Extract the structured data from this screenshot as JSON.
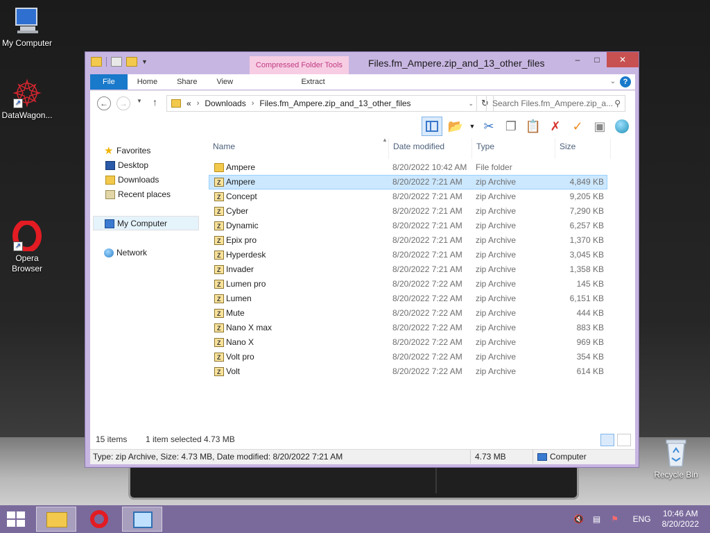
{
  "desktop": {
    "icons": [
      {
        "label": "My Computer"
      },
      {
        "label": "DataWagon..."
      },
      {
        "label": "Opera Browser"
      },
      {
        "label": "Recycle Bin"
      }
    ]
  },
  "window": {
    "title": "Files.fm_Ampere.zip_and_13_other_files",
    "context_tab_header": "Compressed Folder Tools",
    "controls": {
      "minimize": "–",
      "maximize": "□",
      "close": "✕"
    },
    "ribbon_tabs": {
      "file": "File",
      "home": "Home",
      "share": "Share",
      "view": "View",
      "extract": "Extract"
    },
    "address": {
      "overflow": "«",
      "crumbs": [
        "Downloads",
        "Files.fm_Ampere.zip_and_13_other_files"
      ]
    },
    "search_placeholder": "Search Files.fm_Ampere.zip_a...",
    "navigation": {
      "favorites": "Favorites",
      "desktop": "Desktop",
      "downloads": "Downloads",
      "recent": "Recent places",
      "computer": "My Computer",
      "network": "Network"
    },
    "columns": {
      "name": "Name",
      "date": "Date modified",
      "type": "Type",
      "size": "Size"
    },
    "files": [
      {
        "name": "Ampere",
        "date": "8/20/2022 10:42 AM",
        "type": "File folder",
        "size": "",
        "kind": "folder"
      },
      {
        "name": "Ampere",
        "date": "8/20/2022 7:21 AM",
        "type": "zip Archive",
        "size": "4,849 KB",
        "kind": "zip"
      },
      {
        "name": "Concept",
        "date": "8/20/2022 7:21 AM",
        "type": "zip Archive",
        "size": "9,205 KB",
        "kind": "zip"
      },
      {
        "name": "Cyber",
        "date": "8/20/2022 7:21 AM",
        "type": "zip Archive",
        "size": "7,290 KB",
        "kind": "zip"
      },
      {
        "name": "Dynamic",
        "date": "8/20/2022 7:21 AM",
        "type": "zip Archive",
        "size": "6,257 KB",
        "kind": "zip"
      },
      {
        "name": "Epix pro",
        "date": "8/20/2022 7:21 AM",
        "type": "zip Archive",
        "size": "1,370 KB",
        "kind": "zip"
      },
      {
        "name": "Hyperdesk",
        "date": "8/20/2022 7:21 AM",
        "type": "zip Archive",
        "size": "3,045 KB",
        "kind": "zip"
      },
      {
        "name": "Invader",
        "date": "8/20/2022 7:21 AM",
        "type": "zip Archive",
        "size": "1,358 KB",
        "kind": "zip"
      },
      {
        "name": "Lumen pro",
        "date": "8/20/2022 7:22 AM",
        "type": "zip Archive",
        "size": "145 KB",
        "kind": "zip"
      },
      {
        "name": "Lumen",
        "date": "8/20/2022 7:22 AM",
        "type": "zip Archive",
        "size": "6,151 KB",
        "kind": "zip"
      },
      {
        "name": "Mute",
        "date": "8/20/2022 7:22 AM",
        "type": "zip Archive",
        "size": "444 KB",
        "kind": "zip"
      },
      {
        "name": "Nano X max",
        "date": "8/20/2022 7:22 AM",
        "type": "zip Archive",
        "size": "883 KB",
        "kind": "zip"
      },
      {
        "name": "Nano X",
        "date": "8/20/2022 7:22 AM",
        "type": "zip Archive",
        "size": "969 KB",
        "kind": "zip"
      },
      {
        "name": "Volt pro",
        "date": "8/20/2022 7:22 AM",
        "type": "zip Archive",
        "size": "354 KB",
        "kind": "zip"
      },
      {
        "name": "Volt",
        "date": "8/20/2022 7:22 AM",
        "type": "zip Archive",
        "size": "614 KB",
        "kind": "zip"
      }
    ],
    "selected_index": 1,
    "status": {
      "count": "15 items",
      "selection": "1 item selected  4.73 MB"
    },
    "info_bar": {
      "details": "Type: zip Archive, Size: 4.73 MB, Date modified: 8/20/2022 7:21 AM",
      "size": "4.73 MB",
      "location": "Computer"
    }
  },
  "taskbar": {
    "language": "ENG",
    "time": "10:46 AM",
    "date": "8/20/2022"
  },
  "colors": {
    "accent": "#1979ca",
    "window_frame": "#c8b6e2",
    "taskbar": "#7a6a9c",
    "selection": "#cce8ff"
  }
}
